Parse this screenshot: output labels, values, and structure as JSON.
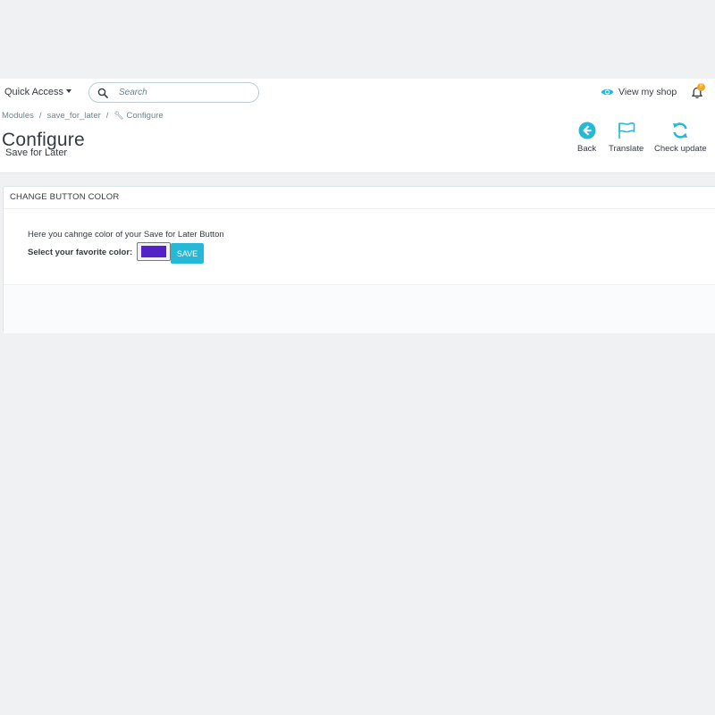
{
  "header": {
    "quick_access_label": "Quick Access",
    "search_placeholder": "Search",
    "view_shop_label": "View my shop",
    "notification_count": "8"
  },
  "breadcrumb": {
    "items": [
      "Modules",
      "save_for_later",
      "Configure"
    ]
  },
  "page": {
    "title": "Configure",
    "subtitle": "Save for Later"
  },
  "toolbar": {
    "back_label": "Back",
    "translate_label": "Translate",
    "check_update_label": "Check update"
  },
  "panel": {
    "heading": "CHANGE BUTTON COLOR",
    "description": "Here you cahnge color of your Save for Later Button",
    "color_label": "Select your favorite color:",
    "selected_color": "#5420c8",
    "save_label": "SAVE"
  },
  "colors": {
    "accent": "#25b9d7",
    "notification_badge": "#f4a62a",
    "background": "#eff1f2"
  }
}
